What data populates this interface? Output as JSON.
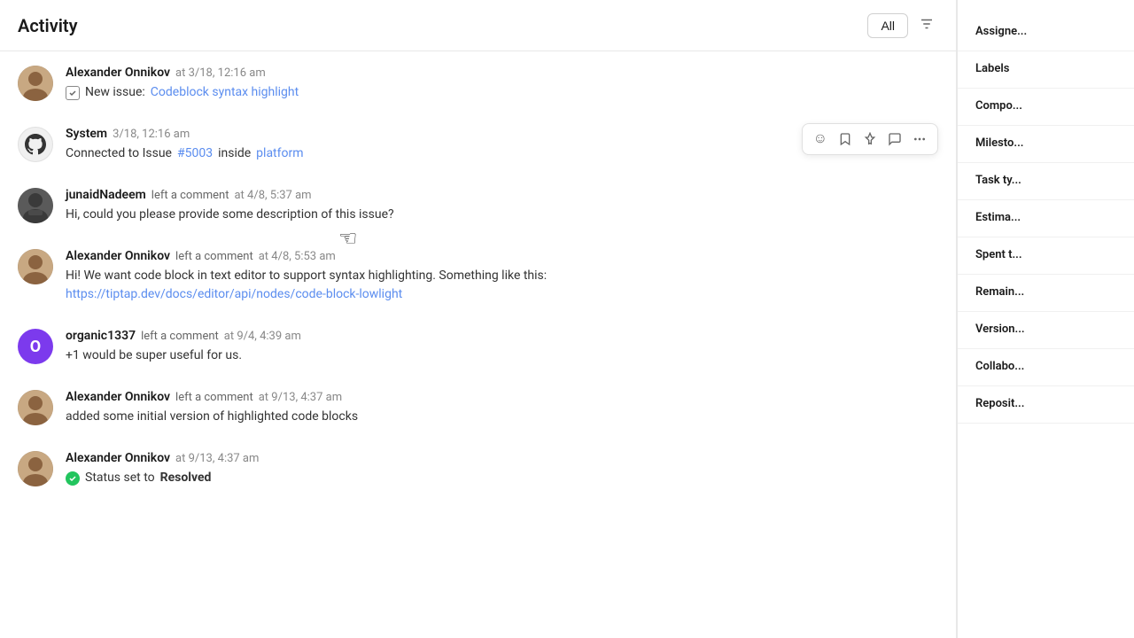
{
  "header": {
    "title": "Activity",
    "all_button": "All"
  },
  "activity_items": [
    {
      "id": "item1",
      "author": "Alexander Onnikov",
      "author_type": "alexander",
      "action": "",
      "time": "at 3/18, 12:16 am",
      "content_type": "new_issue",
      "content_prefix": "New issue:",
      "content_link": "Codeblock syntax highlight",
      "content_link_href": "#"
    },
    {
      "id": "item2",
      "author": "System",
      "author_type": "system",
      "action": "",
      "time": "3/18, 12:16 am",
      "content_type": "connected",
      "content_text": "Connected to Issue",
      "content_link1": "#5003",
      "content_link1_href": "#",
      "content_middle": "inside",
      "content_link2": "platform",
      "content_link2_href": "#",
      "show_hover": true
    },
    {
      "id": "item3",
      "author": "junaidNadeem",
      "author_type": "junaidad",
      "action": "left a comment",
      "time": "at 4/8, 5:37 am",
      "content_type": "text",
      "content_text": "Hi, could you please provide some description of this issue?"
    },
    {
      "id": "item4",
      "author": "Alexander Onnikov",
      "author_type": "alexander",
      "action": "left a comment",
      "time": "at 4/8, 5:53 am",
      "content_type": "text_with_link",
      "content_text": "Hi! We want code block in text editor to support syntax highlighting. Something like this:",
      "content_link": "https://tiptap.dev/docs/editor/api/nodes/code-block-lowlight",
      "content_link_href": "#"
    },
    {
      "id": "item5",
      "author": "organic1337",
      "author_type": "organic",
      "action": "left a comment",
      "time": "at 9/4, 4:39 am",
      "content_type": "text",
      "content_text": "+1 would be super useful for us."
    },
    {
      "id": "item6",
      "author": "Alexander Onnikov",
      "author_type": "alexander",
      "action": "left a comment",
      "time": "at 9/13, 4:37 am",
      "content_type": "text",
      "content_text": "added some initial version of highlighted code blocks"
    },
    {
      "id": "item7",
      "author": "Alexander Onnikov",
      "author_type": "alexander",
      "action": "",
      "time": "at 9/13, 4:37 am",
      "content_type": "status",
      "content_prefix": "Status set to",
      "content_bold": "Resolved"
    }
  ],
  "right_sidebar": {
    "assignee_label": "Assigne...",
    "labels_label": "Labels",
    "component_label": "Compo...",
    "milestone_label": "Milesto...",
    "task_type_label": "Task ty...",
    "estimate_label": "Estima...",
    "spent_time_label": "Spent t...",
    "remaining_label": "Remain...",
    "version_label": "Version...",
    "collaborator_label": "Collabo...",
    "repository_label": "Reposit..."
  },
  "hover_actions": {
    "emoji": "😊",
    "bookmark": "🔖",
    "pin": "📌",
    "comment": "💬",
    "more": "⋯"
  }
}
